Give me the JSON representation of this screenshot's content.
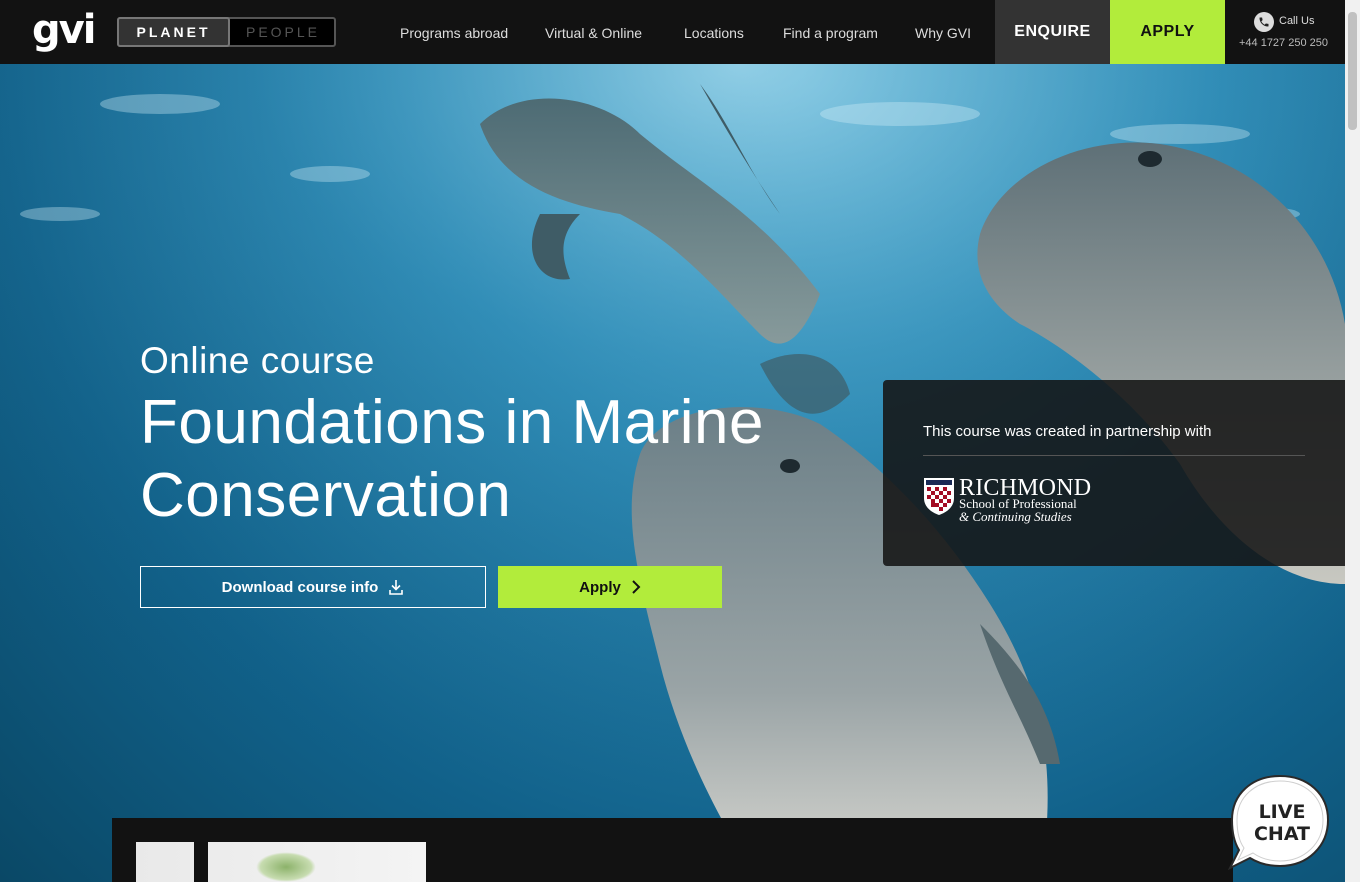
{
  "header": {
    "logo": "gvi",
    "toggle": {
      "active": "PLANET",
      "inactive": "PEOPLE"
    },
    "nav": [
      "Programs abroad",
      "Virtual & Online",
      "Locations",
      "Find a program",
      "Why GVI"
    ],
    "enquire": "ENQUIRE",
    "apply": "APPLY",
    "call_label": "Call Us",
    "phone": "+44 1727 250 250"
  },
  "hero": {
    "eyebrow": "Online course",
    "title": "Foundations in Marine Conservation",
    "download_label": "Download course info",
    "apply_label": "Apply"
  },
  "partner": {
    "text": "This course was created in partnership with",
    "logo_name": "RICHMOND",
    "logo_line1": "School of Professional",
    "logo_line2": "& Continuing Studies"
  },
  "livechat": {
    "line1": "LIVE",
    "line2": "CHAT"
  },
  "colors": {
    "accent": "#b2ec3b",
    "topbar": "#121212"
  },
  "icons": [
    "phone-icon",
    "download-icon",
    "chevron-right-icon",
    "richmond-shield-icon",
    "live-chat-bubble-icon"
  ]
}
